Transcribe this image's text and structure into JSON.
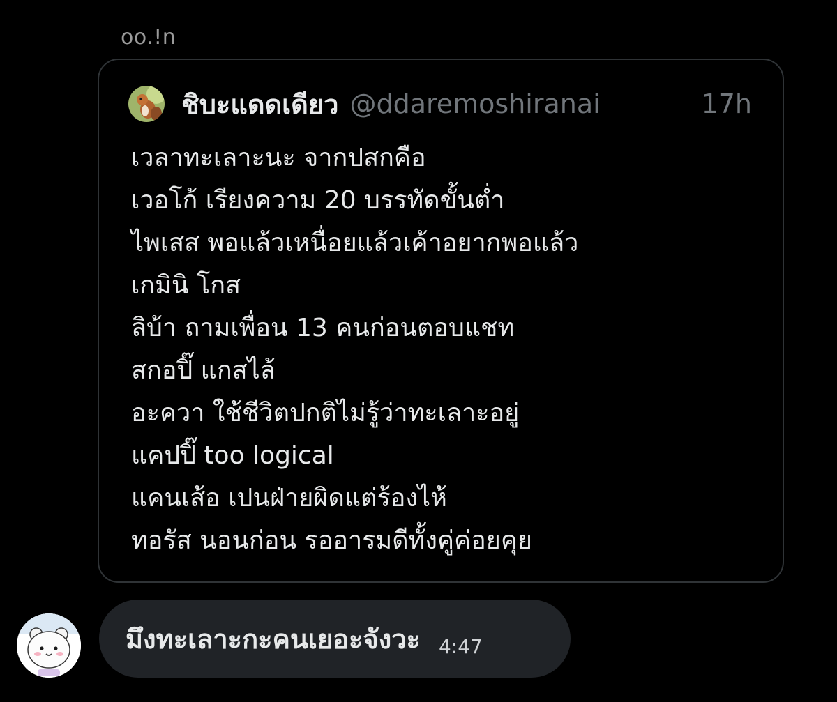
{
  "sender": {
    "name": "oo.!n"
  },
  "quote": {
    "author_display_name": "ชิบะแดดเดียว",
    "author_handle": "@ddaremoshiranai",
    "time_ago": "17h",
    "lines": [
      "เวลาทะเลาะนะ จากปสกคือ",
      "เวอโก้ เรียงความ 20 บรรทัดขั้นต่ำ",
      "ไพเสส พอแล้วเหนื่อยแล้วเค้าอยากพอแล้ว",
      "เกมินิ โกส",
      "ลิบ้า ถามเพื่อน 13 คนก่อนตอบแชท",
      "สกอปิ๊ แกสไล้",
      "อะควา ใช้ชีวิตปกติไม่รู้ว่าทะเลาะอยู่",
      "แคปปิ๊ too logical",
      "แคนเส้อ เปนฝ่ายผิดแต่ร้องไห้",
      "ทอรัส นอนก่อน รออารมดีทั้งคู่ค่อยคุย"
    ]
  },
  "reply": {
    "text": "มึงทะเลาะกะคนเยอะจังวะ",
    "time": "4:47"
  },
  "icons": {
    "quote_avatar": "squirrel-avatar-icon",
    "reply_avatar": "white-bear-avatar-icon"
  },
  "colors": {
    "background": "#000000",
    "card_border": "#2f3336",
    "bubble": "#202327",
    "primary_text": "#e7e9ea",
    "secondary_text": "#71767b"
  }
}
